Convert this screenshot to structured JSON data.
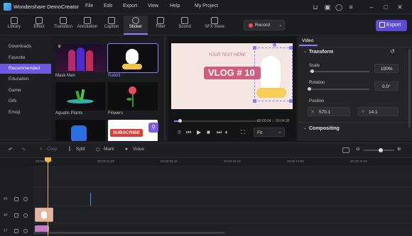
{
  "app": {
    "title": "Wondershare DemoCreator",
    "project": "My Project"
  },
  "menu": [
    "File",
    "Edit",
    "Export",
    "View",
    "Help"
  ],
  "toolbar": {
    "tabs": [
      "Library",
      "Effect",
      "Transition",
      "Annotation",
      "Caption",
      "Sticker",
      "Filter",
      "Sound",
      "SFX Store"
    ],
    "active_tab": "Sticker",
    "record_label": "Record",
    "export_label": "Export"
  },
  "categories": {
    "items": [
      "Downloads",
      "Favorite",
      "Recommended",
      "Education",
      "Game",
      "Gifs",
      "Emoji"
    ],
    "active": "Recommended"
  },
  "stickers": [
    {
      "label": "Mask Man"
    },
    {
      "label": "Rabbit"
    },
    {
      "label": "Aquatic Plants"
    },
    {
      "label": "Flowers"
    },
    {
      "label": ""
    },
    {
      "label": ""
    }
  ],
  "sticker_text": {
    "subscribe": "SUBSCRIBE"
  },
  "preview": {
    "canvas_small_text": "YOUR TEXT HERE",
    "canvas_title": "VLOG # 10",
    "current_time": "00:00:04",
    "total_time": "00:04:30",
    "fit_label": "Fit"
  },
  "properties": {
    "tab": "Video",
    "section_transform": "Transform",
    "scale_label": "Scale",
    "scale_value": "100%",
    "scale_level": 0.05,
    "rotation_label": "Rotation",
    "rotation_value": "0.0°",
    "rotation_level": 0.0,
    "position_label": "Position",
    "pos_x_label": "X",
    "pos_x_value": "570.1",
    "pos_y_label": "Y",
    "pos_y_value": "14.1",
    "section_compositing": "Compositing"
  },
  "timeline_tools": {
    "crop": "Crop",
    "split": "Split",
    "mark": "Mark",
    "voice": "Voice"
  },
  "ruler": [
    "00:00:00:00",
    "00:00:02:03",
    "00:00:04:18",
    "00:00:10:12",
    "00:00:13:08",
    "00:00:44:04"
  ],
  "tracks": [
    {
      "number": "49"
    },
    {
      "number": "48"
    },
    {
      "number": "47"
    }
  ],
  "colors": {
    "accent": "#8f7cff",
    "active_category": "#6d5ae0",
    "export": "#5b4bd6",
    "playhead": "#f3b63f"
  }
}
